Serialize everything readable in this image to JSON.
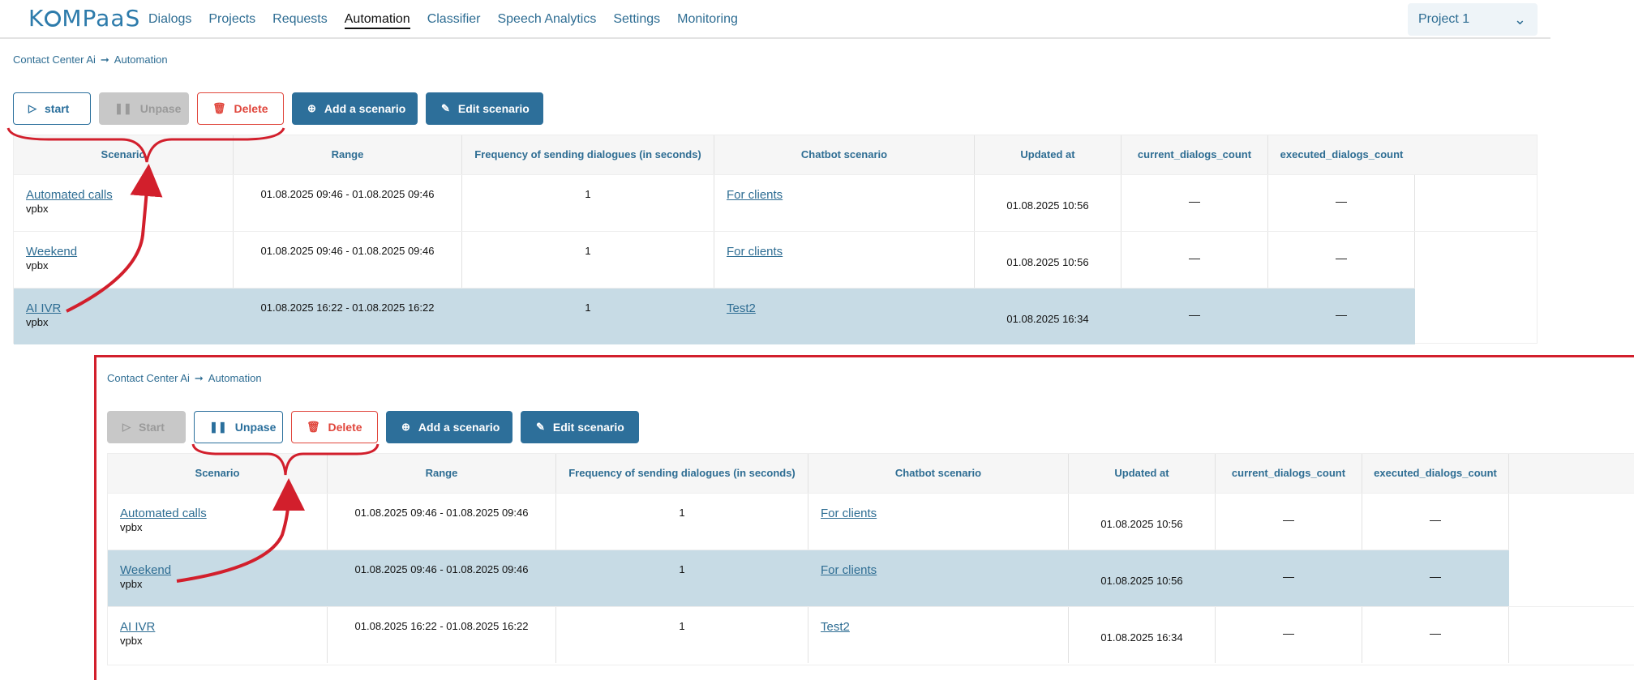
{
  "app": {
    "logo": "KOMPaaS",
    "nav": [
      "Dialogs",
      "Projects",
      "Requests",
      "Automation",
      "Classifier",
      "Speech Analytics",
      "Settings",
      "Monitoring"
    ],
    "active_nav": "Automation",
    "project_select": "Project 1"
  },
  "breadcrumb": {
    "root": "Contact Center Ai",
    "current": "Automation"
  },
  "table_headers": [
    "Scenario",
    "Range",
    "Frequency of sending dialogues (in seconds)",
    "Chatbot scenario",
    "Updated at",
    "current_dialogs_count",
    "executed_dialogs_count"
  ],
  "rows": [
    {
      "scenario": "Automated calls",
      "sub": "vpbx",
      "range": "01.08.2025 09:46 - 01.08.2025 09:46",
      "freq": "1",
      "chatbot": "For clients",
      "updated": "01.08.2025 10:56",
      "current": "—",
      "executed": "—"
    },
    {
      "scenario": "Weekend",
      "sub": "vpbx",
      "range": "01.08.2025 09:46 - 01.08.2025 09:46",
      "freq": "1",
      "chatbot": "For clients",
      "updated": "01.08.2025 10:56",
      "current": "—",
      "executed": "—"
    },
    {
      "scenario": "AI IVR",
      "sub": "vpbx",
      "range": "01.08.2025 16:22 - 01.08.2025 16:22",
      "freq": "1",
      "chatbot": "Test2",
      "updated": "01.08.2025 16:34",
      "current": "—",
      "executed": "—"
    }
  ],
  "panel_top": {
    "buttons": {
      "start": "start",
      "unpause": "Unpase",
      "delete": "Delete",
      "add": "Add a scenario",
      "edit": "Edit  scenario"
    },
    "selected_row": 2
  },
  "panel_bottom": {
    "buttons": {
      "start": "Start",
      "unpause": "Unpase",
      "delete": "Delete",
      "add": "Add a scenario",
      "edit": "Edit  scenario"
    },
    "selected_row": 1
  },
  "colors": {
    "accent": "#2d6f9a",
    "danger": "#e0463c",
    "selected_row": "#c7dbe5",
    "annotation": "#d21f2c"
  }
}
